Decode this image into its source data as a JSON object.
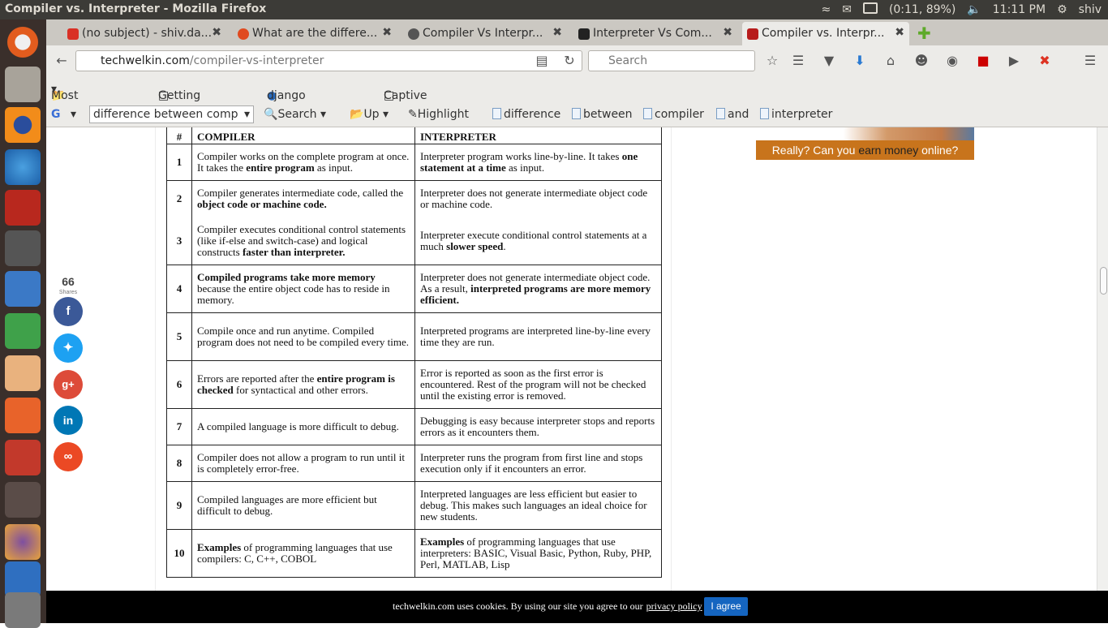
{
  "window": {
    "title": "Compiler vs. Interpreter - Mozilla Firefox",
    "battery": "(0:11, 89%)",
    "clock": "11:11 PM",
    "user": "shiv"
  },
  "tabs": [
    {
      "label": "(no subject) - shiv.da...",
      "color": "#d93025"
    },
    {
      "label": "What are the differe...",
      "color": "#e04a1f"
    },
    {
      "label": "Compiler Vs Interpr...",
      "color": "#444444"
    },
    {
      "label": "Interpreter Vs Com...",
      "color": "#222222"
    },
    {
      "label": "Compiler vs. Interpr...",
      "color": "#b71c1c"
    }
  ],
  "nav": {
    "url_domain": "techwelkin.com",
    "url_path": "/compiler-vs-interpreter",
    "search_placeholder": "Search"
  },
  "bookmarks": {
    "most_visited": "Most Visited",
    "getting_started": "Getting Started",
    "django": "django local_site",
    "captive": "Captive Portal"
  },
  "searchbar": {
    "query": "difference between comp",
    "search": "Search",
    "up": "Up",
    "highlight": "Highlight",
    "terms": [
      "difference",
      "between",
      "compiler",
      "and",
      "interpreter"
    ]
  },
  "table": {
    "headers": [
      "#",
      "COMPILER",
      "INTERPRETER"
    ],
    "rows": [
      {
        "n": "1",
        "compiler": "Compiler works on the complete program at once. It takes the entire program as input.",
        "interpreter": "Interpreter program works line-by-line. It takes one statement at a time as input."
      },
      {
        "n": "2",
        "compiler": "Compiler generates intermediate code, called the object code or machine code.",
        "interpreter": "Interpreter does not generate intermediate object code or machine code."
      },
      {
        "n": "3",
        "compiler": "Compiler executes conditional control statements (like if-else and switch-case) and logical constructs faster than interpreter.",
        "interpreter": "Interpreter execute conditional control statements at a much slower speed."
      },
      {
        "n": "4",
        "compiler": "Compiled programs take more memory because the entire object code has to reside in memory.",
        "interpreter": "Interpreter does not generate intermediate object code. As a result, interpreted programs are more memory efficient."
      },
      {
        "n": "5",
        "compiler": "Compile once and run anytime. Compiled program does not need to be compiled every time.",
        "interpreter": "Interpreted programs are interpreted line-by-line every time they are run."
      },
      {
        "n": "6",
        "compiler": "Errors are reported after the entire program is checked for syntactical  and other errors.",
        "interpreter": "Error is reported as soon as the first error is encountered. Rest of the program will not be checked until the existing error is removed."
      },
      {
        "n": "7",
        "compiler": "A compiled language is more difficult to debug.",
        "interpreter": "Debugging is easy because interpreter stops and reports errors as it encounters them."
      },
      {
        "n": "8",
        "compiler": "Compiler does not allow a program to run until it is completely error-free.",
        "interpreter": "Interpreter runs the program from first line and stops execution only if it encounters an error."
      },
      {
        "n": "9",
        "compiler": "Compiled languages are more efficient but difficult to debug.",
        "interpreter": "Interpreted languages are less efficient but easier to debug. This makes such languages an ideal choice for new students."
      },
      {
        "n": "10",
        "compiler": "Examples of programming languages that use compilers: C,  C++, COBOL",
        "interpreter": "Examples of programming languages that use interpreters: BASIC, Visual Basic, Python, Ruby, PHP, Perl, MATLAB, Lisp"
      }
    ]
  },
  "shares": {
    "count": "66",
    "label": "Shares"
  },
  "ad": {
    "text_a": "Really? Can you ",
    "text_b": "earn money",
    "text_c": " online?"
  },
  "cookie": {
    "message": "techwelkin.com uses cookies. By using our site you agree to our",
    "link": "privacy policy",
    "button": "I agree"
  },
  "colors": {
    "facebook": "#3b5998",
    "twitter": "#1da1f2",
    "googleplus": "#dd4b39",
    "linkedin": "#0077b5",
    "stumbleupon": "#eb4924"
  }
}
